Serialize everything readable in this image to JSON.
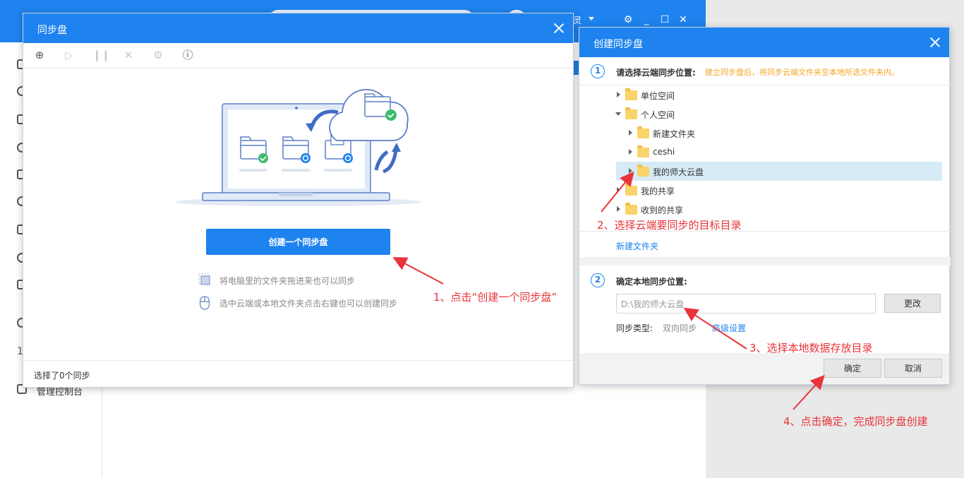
{
  "background_app": {
    "user_fragment": "灵",
    "sidebar_last_item": "管理控制台",
    "sidebar_number": "1"
  },
  "sync_dialog": {
    "title": "同步盘",
    "toolbar": [
      "add-sync-icon",
      "play-icon",
      "pause-icon",
      "delete-icon",
      "settings-icon",
      "info-icon"
    ],
    "create_button": "创建一个同步盘",
    "hint_drag": "将电脑里的文件夹拖进来也可以同步",
    "hint_rightclick": "选中云端或本地文件夹点击右键也可以创建同步",
    "footer_status": "选择了0个同步"
  },
  "create_dialog": {
    "title": "创建同步盘",
    "step1": {
      "number": "1",
      "label": "请选择云端同步位置:",
      "hint": "建立同步盘后，将同步云端文件夹至本地所选文件夹内。"
    },
    "tree": [
      {
        "label": "单位空间",
        "level": 0,
        "expanded": false,
        "selected": false
      },
      {
        "label": "个人空间",
        "level": 0,
        "expanded": true,
        "selected": false
      },
      {
        "label": "新建文件夹",
        "level": 1,
        "expanded": false,
        "selected": false
      },
      {
        "label": "ceshi",
        "level": 1,
        "expanded": false,
        "selected": false
      },
      {
        "label": "我的师大云盘",
        "level": 1,
        "expanded": false,
        "selected": true
      },
      {
        "label": "我的共享",
        "level": 0,
        "expanded": false,
        "selected": false
      },
      {
        "label": "收到的共享",
        "level": 0,
        "expanded": false,
        "selected": false
      }
    ],
    "new_folder_link": "新建文件夹",
    "step2": {
      "number": "2",
      "label": "确定本地同步位置:",
      "path_value": "D:\\我的师大云盘",
      "change_button": "更改",
      "sync_type_label": "同步类型:",
      "sync_type_value": "双向同步",
      "advanced_link": "高级设置"
    },
    "ok_button": "确定",
    "cancel_button": "取消"
  },
  "annotations": {
    "step1": "1、点击“创建一个同步盘”",
    "step2": "2、选择云端要同步的目标目录",
    "step3": "3、选择本地数据存放目录",
    "step4": "4、点击确定，完成同步盘创建"
  },
  "colors": {
    "accent": "#1e83ee",
    "annotation": "#e8343a",
    "hint_orange": "#f5a623",
    "selected_row": "#d6ebf5",
    "folder": "#f9d46b",
    "check_green": "#3dbb6d"
  }
}
